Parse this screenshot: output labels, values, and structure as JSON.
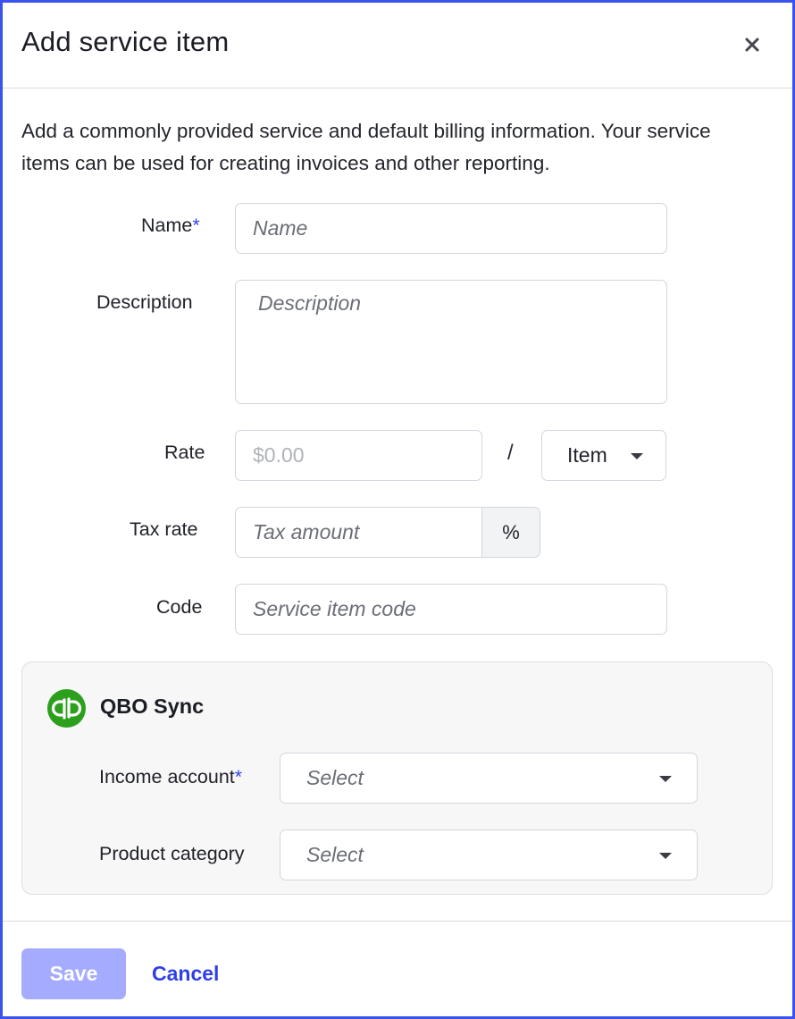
{
  "dialog": {
    "title": "Add service item",
    "description": "Add a commonly provided service and default billing information. Your service items can be used for creating invoices and other reporting."
  },
  "form": {
    "name": {
      "label": "Name",
      "required_mark": "*",
      "placeholder": "Name"
    },
    "description": {
      "label": "Description",
      "placeholder": "Description"
    },
    "rate": {
      "label": "Rate",
      "placeholder": "$0.00",
      "separator": "/",
      "unit": "Item"
    },
    "tax_rate": {
      "label": "Tax rate",
      "placeholder": "Tax amount",
      "suffix": "%"
    },
    "code": {
      "label": "Code",
      "placeholder": "Service item code"
    }
  },
  "qbo_sync": {
    "title": "QBO Sync",
    "logo_icon": "quickbooks-logo-icon",
    "brand_color": "#2ca01c",
    "income_account": {
      "label": "Income account",
      "required_mark": "*",
      "value": "Select"
    },
    "product_category": {
      "label": "Product category",
      "value": "Select"
    }
  },
  "footer": {
    "save_label": "Save",
    "cancel_label": "Cancel"
  },
  "colors": {
    "accent": "#2f3fe8",
    "save_disabled": "#a5acff",
    "border": "#3a52ee"
  }
}
